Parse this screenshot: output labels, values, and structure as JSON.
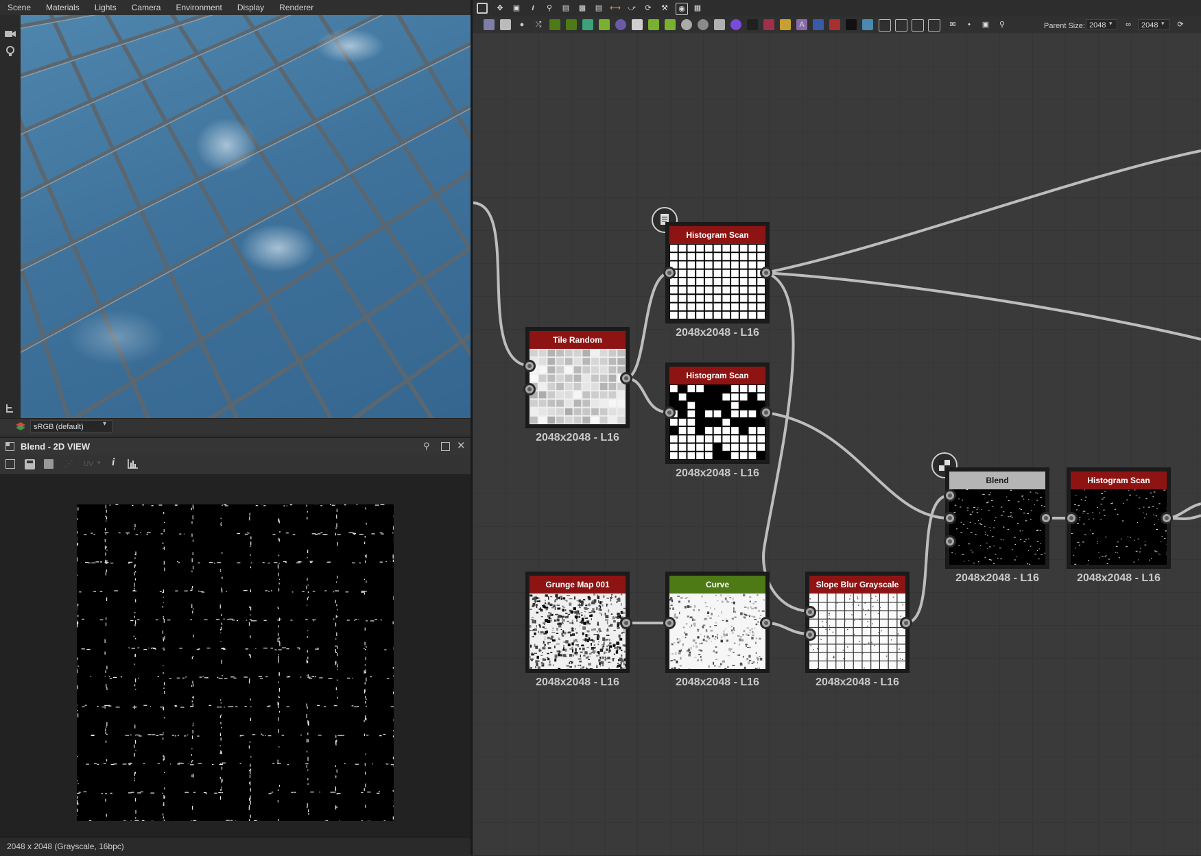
{
  "menu": [
    "Scene",
    "Materials",
    "Lights",
    "Camera",
    "Environment",
    "Display",
    "Renderer"
  ],
  "viewport": {
    "color_space": "sRGB (default)",
    "tile_color": "#3f739c",
    "grout_color": "#5b6770"
  },
  "panel_2d": {
    "title": "Blend - 2D VIEW",
    "uv_label": "UV",
    "info_icon": "i",
    "status": "2048 x 2048 (Grayscale, 16bpc)"
  },
  "graph_toolbar": {
    "parent_size_label": "Parent Size:",
    "parent_size_value": "2048",
    "output_size_value": "2048"
  },
  "nodes": [
    {
      "id": "tile-random",
      "title": "Tile Random",
      "size": "2048x2048 - L16",
      "header": "red"
    },
    {
      "id": "histogram-scan-1",
      "title": "Histogram Scan",
      "size": "2048x2048 - L16",
      "header": "red"
    },
    {
      "id": "histogram-scan-2",
      "title": "Histogram Scan",
      "size": "2048x2048 - L16",
      "header": "red"
    },
    {
      "id": "grunge-map",
      "title": "Grunge Map 001",
      "size": "2048x2048 - L16",
      "header": "red"
    },
    {
      "id": "curve",
      "title": "Curve",
      "size": "2048x2048 - L16",
      "header": "green"
    },
    {
      "id": "slope-blur",
      "title": "Slope Blur Grayscale",
      "size": "2048x2048 - L16",
      "header": "red"
    },
    {
      "id": "blend",
      "title": "Blend",
      "size": "2048x2048 - L16",
      "header": "gray"
    },
    {
      "id": "histogram-scan-3",
      "title": "Histogram Scan",
      "size": "2048x2048 - L16",
      "header": "red"
    }
  ],
  "colors": {
    "node_red": "#8e1414",
    "node_green": "#4d7a15",
    "node_gray": "#b5b5b5",
    "wire": "#bdbdbd"
  }
}
